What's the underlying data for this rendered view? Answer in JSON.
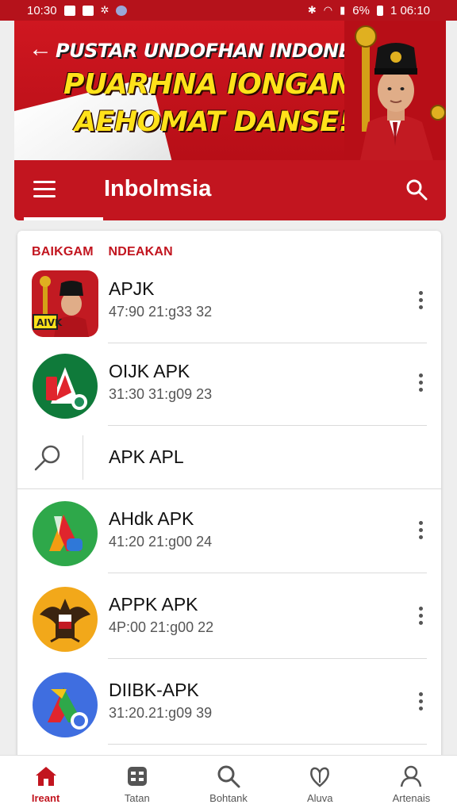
{
  "status_bar": {
    "time": "10:30",
    "battery": "6%",
    "clock_right": "1 06:10"
  },
  "hero": {
    "line1": "PUSTAR UNDOFHAN INDONESIA",
    "line2": "PUARHNA IONGAN",
    "line3": "AEHOMAT DANSE!"
  },
  "app_bar": {
    "title": "Inbolmsia"
  },
  "section": {
    "label_a": "BAIKGAM",
    "label_b": "NDEAKAN"
  },
  "rows": [
    {
      "title": "APJK",
      "subtitle": "47:90 21:g33 32",
      "icon": "portrait-app-icon"
    },
    {
      "title": "OIJK APK",
      "subtitle": "31:30 31:g09 23",
      "icon": "green-a-app-icon"
    },
    {
      "title": "AHdk APK",
      "subtitle": "41:20 21:g00 24",
      "icon": "colorful-a-app-icon"
    },
    {
      "title": "APPK APK",
      "subtitle": "4P:00 21:g00 22",
      "icon": "garuda-app-icon"
    },
    {
      "title": "DIIBK-APK",
      "subtitle": "31:20.21:g09 39",
      "icon": "blue-a-app-icon"
    }
  ],
  "search_row": {
    "label": "APK APL"
  },
  "bottom_nav": [
    {
      "label": "Ireant",
      "icon": "home-icon",
      "active": true
    },
    {
      "label": "Tatan",
      "icon": "grid-card-icon",
      "active": false
    },
    {
      "label": "Bohtank",
      "icon": "search-icon",
      "active": false
    },
    {
      "label": "Aluva",
      "icon": "leaf-heart-icon",
      "active": false
    },
    {
      "label": "Artenais",
      "icon": "person-icon",
      "active": false
    }
  ],
  "colors": {
    "brand_red": "#c2151f",
    "accent_yellow": "#ffe21a"
  }
}
